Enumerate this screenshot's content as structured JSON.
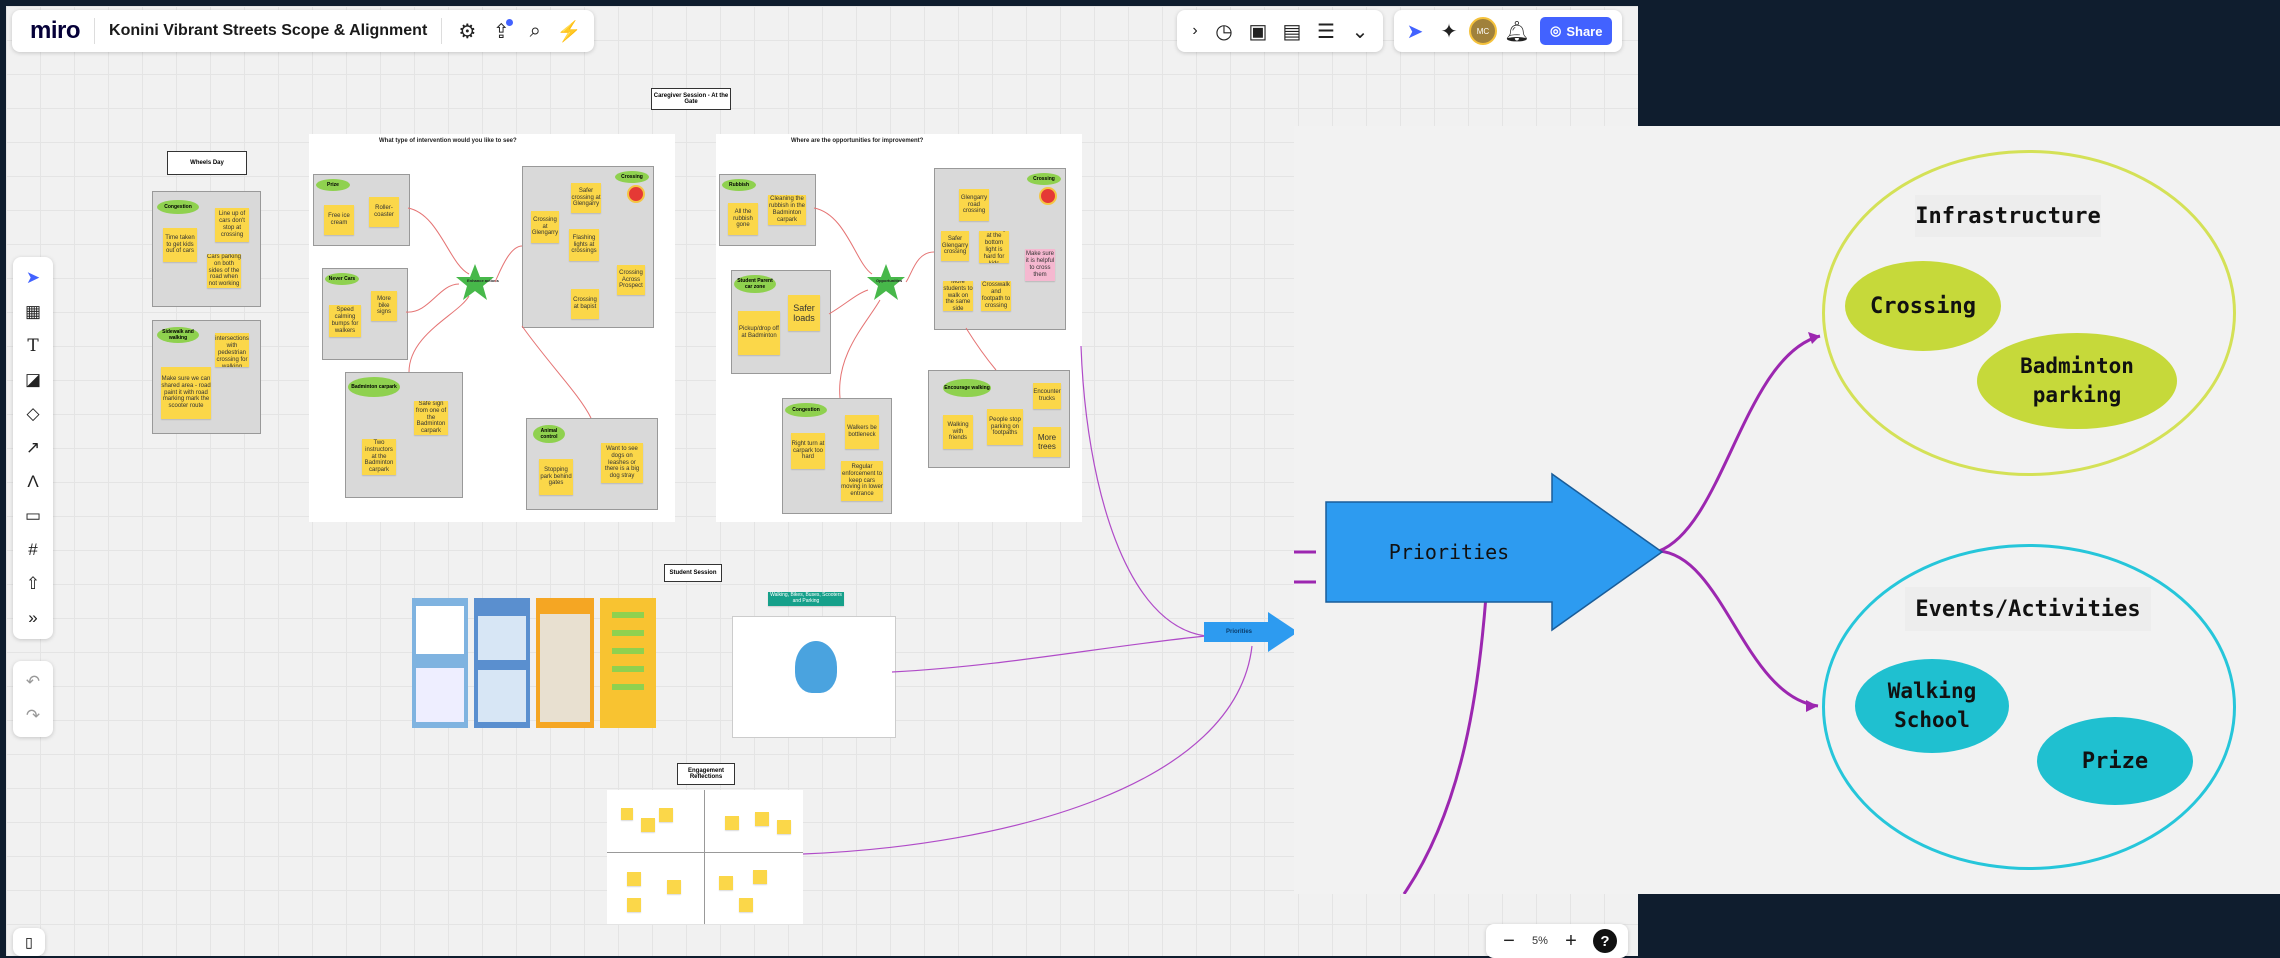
{
  "app": {
    "logo": "miro",
    "board_title": "Konini Vibrant Streets Scope & Alignment",
    "share_label": "Share",
    "avatar_initials": "MC"
  },
  "zoom": {
    "level": "5%"
  },
  "board": {
    "caregiver_label": "Caregiver Session - At the Gate",
    "student_label": "Student Session",
    "reflections_label": "Engagement Reflections",
    "wheels_label": "Wheels Day",
    "frame1_question": "What type of intervention would you like to see?",
    "frame2_question": "Where are the opportunities for improvement?",
    "priorities_small": "Priorities",
    "student_note": "Walking, Bikes, Buses, Scooters and Parking"
  },
  "frame1": {
    "groups": [
      {
        "title": "Prize",
        "notes": [
          "Free ice cream",
          "Roller-coaster"
        ]
      },
      {
        "title": "Never Cars",
        "notes": [
          "Speed calming bumps for walkers",
          "More bike signs"
        ]
      },
      {
        "title": "Badminton carpark",
        "notes": [
          "Two instructors at the Badminton carpark",
          "Safe sign from one of the Badminton carpark"
        ]
      },
      {
        "title": "Crossing",
        "notes": [
          "Safer crossing at Glengarry",
          "Crossing at Glengarry",
          "Flashing lights at crossings",
          "Crossing at bapist",
          "Crossing Across Prospect"
        ]
      },
      {
        "title": "Animal control",
        "notes": [
          "Stopping park behind gates",
          "Want to see dogs on leashes or there is a big dog stray"
        ]
      }
    ],
    "center": "Enhance actions"
  },
  "frame2": {
    "groups": [
      {
        "title": "Rubbish",
        "notes": [
          "All the rubbish gone",
          "Cleaning the rubbish in the Badminton carpark"
        ]
      },
      {
        "title": "Student Parent car zone",
        "notes": [
          "Pickup/drop off at Badminton",
          "Safer loads"
        ]
      },
      {
        "title": "Congestion",
        "notes": [
          "Right turn at carpark too hard",
          "Walkers be bottleneck",
          "Regular enforcement to keep cars moving in lower entrance"
        ]
      },
      {
        "title": "Crossing",
        "notes": [
          "Glengarry road crossing",
          "Safer Glengarry crossing",
          "Crossing at the bottom light is hard for kids",
          "Make sure it is helpful to cross them",
          "Crosswalk and footpath to crossing",
          "More students to walk on the same side"
        ]
      },
      {
        "title": "Encourage walking",
        "notes": [
          "Walking with friends",
          "People stop parking on footpaths",
          "Encounter trucks",
          "More trees"
        ]
      }
    ],
    "center": "Opportunities"
  },
  "wheels": {
    "groups": [
      {
        "title": "Congestion",
        "notes": [
          "Time taken to get kids out of cars",
          "Line up of cars don't stop at crossing",
          "Cars parking on both sides of the road when not working"
        ]
      },
      {
        "title": "Sidewalk and walking",
        "notes": [
          "Make sure we can shared area - road paint it with road marking mark the scooter route",
          "Create intersections with pedestrian crossing for walking"
        ]
      }
    ]
  },
  "mindmap": {
    "center": "Priorities",
    "top_group": {
      "label": "Infrastructure",
      "items": [
        "Crossing",
        "Badminton parking"
      ]
    },
    "bottom_group": {
      "label": "Events/Activities",
      "items": [
        "Walking School",
        "Prize"
      ]
    }
  },
  "colors": {
    "sticky": "#fbd749",
    "green": "#8fd14f",
    "blue_arrow": "#2d9bf0",
    "lime": "#d4e157",
    "cyan": "#26c6da",
    "purple": "#9c27b0",
    "accent": "#4262ff"
  }
}
